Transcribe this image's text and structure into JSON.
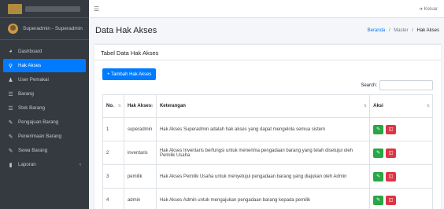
{
  "sidebar": {
    "user": "Superadmin - Superadmin",
    "items": [
      {
        "label": "Dashboard",
        "icon": "dashboard-icon"
      },
      {
        "label": "Hak Akses",
        "icon": "key-icon",
        "active": true
      },
      {
        "label": "User Pemakai",
        "icon": "user-icon"
      },
      {
        "label": "Barang",
        "icon": "list-icon"
      },
      {
        "label": "Stok Barang",
        "icon": "list-icon"
      },
      {
        "label": "Pengajuan Barang",
        "icon": "edit-icon"
      },
      {
        "label": "Penerimaan Barang",
        "icon": "edit-icon"
      },
      {
        "label": "Sewa Barang",
        "icon": "edit-icon"
      },
      {
        "label": "Laporan",
        "icon": "file-icon"
      }
    ]
  },
  "topbar": {
    "logout": "Keluar"
  },
  "page": {
    "title": "Data Hak Akses",
    "breadcrumb": {
      "home": "Beranda",
      "sep": "/",
      "mid": "Master",
      "current": "Hak Akses"
    }
  },
  "card": {
    "title": "Tabel Data Hak Akses",
    "add_button": "+ Tambah Hak Akses",
    "search_label": "Search:",
    "search_value": "",
    "columns": [
      "No.",
      "Hak Akses",
      "Keterangan",
      "Aksi"
    ],
    "rows": [
      {
        "no": "1",
        "hak": "superadmin",
        "ket": "Hak Akses Superadmin adalah hak akses yang dapat mengelola semua sistem"
      },
      {
        "no": "2",
        "hak": "inventaris",
        "ket": "Hak Akses Inventaris berfungsi untuk menerima pengadaan barang yang telah disetujui oleh Pemilik Usaha"
      },
      {
        "no": "3",
        "hak": "pemilik",
        "ket": "Hak Akses Pemilik Usaha untuk menyetujui pengadaan barang yang diajukan oleh Admin"
      },
      {
        "no": "4",
        "hak": "admin",
        "ket": "Hak Akses Admin untuk mengajukan pengadaan barang kepada pemilik"
      }
    ]
  },
  "colors": {
    "sidebar": "#343a40",
    "accent": "#007bff",
    "edit": "#28a745",
    "delete": "#dc3545"
  }
}
